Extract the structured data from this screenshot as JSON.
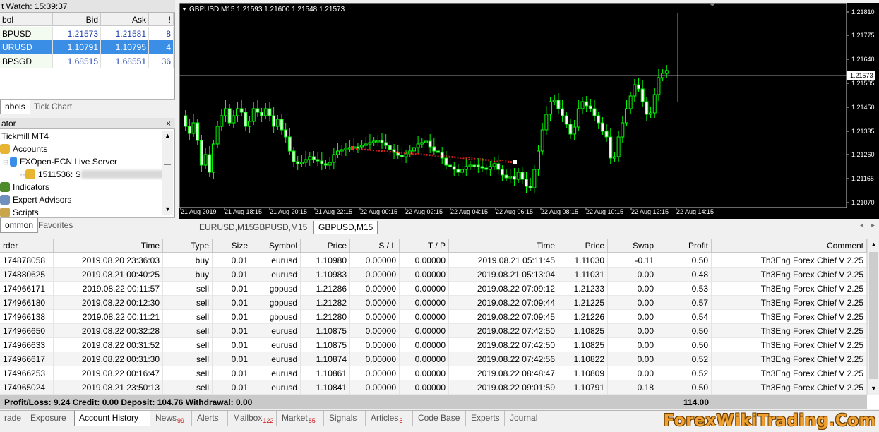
{
  "market_watch": {
    "title": "t Watch: 15:39:37",
    "columns": [
      "bol",
      "Bid",
      "Ask",
      "!"
    ],
    "rows": [
      {
        "symbol": "BPUSD",
        "bid": "1.21573",
        "ask": "1.21581",
        "spread": "8",
        "selected": false
      },
      {
        "symbol": "URUSD",
        "bid": "1.10791",
        "ask": "1.10795",
        "spread": "4",
        "selected": true
      },
      {
        "symbol": "BPSGD",
        "bid": "1.68515",
        "ask": "1.68551",
        "spread": "36",
        "selected": false
      }
    ],
    "tabs": [
      "nbols",
      "Tick Chart"
    ]
  },
  "navigator": {
    "title": "ator",
    "close": "×",
    "items": [
      "Tickmill MT4",
      "Accounts",
      "FXOpen-ECN Live Server",
      "1511536: S",
      "Indicators",
      "Expert Advisors",
      "Scripts"
    ],
    "tabs": [
      "ommon",
      "Favorites"
    ]
  },
  "chart": {
    "header": "GBPUSD,M15  1.21593 1.21600 1.21548 1.21573",
    "current_price": "1.21573",
    "price_labels": [
      "1.21810",
      "1.21775",
      "1.21640",
      "1.21505",
      "1.21450",
      "1.21335",
      "1.21260",
      "1.21165",
      "1.21070"
    ],
    "time_labels": [
      "21 Aug 2019",
      "21 Aug 18:15",
      "21 Aug 20:15",
      "21 Aug 22:15",
      "22 Aug 00:15",
      "22 Aug 02:15",
      "22 Aug 04:15",
      "22 Aug 06:15",
      "22 Aug 08:15",
      "22 Aug 10:15",
      "22 Aug 12:15",
      "22 Aug 14:15"
    ],
    "tabs": [
      "EURUSD,M15",
      "GBPUSD,M15",
      "GBPUSD,M15"
    ]
  },
  "terminal": {
    "columns": [
      "rder",
      "Time",
      "Type",
      "Size",
      "Symbol",
      "Price",
      "S / L",
      "T / P",
      "Time",
      "Price",
      "Swap",
      "Profit",
      "Comment"
    ],
    "rows": [
      [
        "174878058",
        "2019.08.20 23:36:03",
        "buy",
        "0.01",
        "eurusd",
        "1.10980",
        "0.00000",
        "0.00000",
        "2019.08.21 05:11:45",
        "1.11030",
        "-0.11",
        "0.50",
        "Th3Eng Forex Chief V 2.25"
      ],
      [
        "174880625",
        "2019.08.21 00:40:25",
        "buy",
        "0.01",
        "eurusd",
        "1.10983",
        "0.00000",
        "0.00000",
        "2019.08.21 05:13:04",
        "1.11031",
        "0.00",
        "0.48",
        "Th3Eng Forex Chief V 2.25"
      ],
      [
        "174966171",
        "2019.08.22 00:11:57",
        "sell",
        "0.01",
        "gbpusd",
        "1.21286",
        "0.00000",
        "0.00000",
        "2019.08.22 07:09:12",
        "1.21233",
        "0.00",
        "0.53",
        "Th3Eng Forex Chief V 2.25"
      ],
      [
        "174966180",
        "2019.08.22 00:12:30",
        "sell",
        "0.01",
        "gbpusd",
        "1.21282",
        "0.00000",
        "0.00000",
        "2019.08.22 07:09:44",
        "1.21225",
        "0.00",
        "0.57",
        "Th3Eng Forex Chief V 2.25"
      ],
      [
        "174966138",
        "2019.08.22 00:11:21",
        "sell",
        "0.01",
        "gbpusd",
        "1.21280",
        "0.00000",
        "0.00000",
        "2019.08.22 07:09:45",
        "1.21226",
        "0.00",
        "0.54",
        "Th3Eng Forex Chief V 2.25"
      ],
      [
        "174966650",
        "2019.08.22 00:32:28",
        "sell",
        "0.01",
        "eurusd",
        "1.10875",
        "0.00000",
        "0.00000",
        "2019.08.22 07:42:50",
        "1.10825",
        "0.00",
        "0.50",
        "Th3Eng Forex Chief V 2.25"
      ],
      [
        "174966633",
        "2019.08.22 00:31:52",
        "sell",
        "0.01",
        "eurusd",
        "1.10875",
        "0.00000",
        "0.00000",
        "2019.08.22 07:42:50",
        "1.10825",
        "0.00",
        "0.50",
        "Th3Eng Forex Chief V 2.25"
      ],
      [
        "174966617",
        "2019.08.22 00:31:30",
        "sell",
        "0.01",
        "eurusd",
        "1.10874",
        "0.00000",
        "0.00000",
        "2019.08.22 07:42:56",
        "1.10822",
        "0.00",
        "0.52",
        "Th3Eng Forex Chief V 2.25"
      ],
      [
        "174966253",
        "2019.08.22 00:16:47",
        "sell",
        "0.01",
        "eurusd",
        "1.10861",
        "0.00000",
        "0.00000",
        "2019.08.22 08:48:47",
        "1.10809",
        "0.00",
        "0.52",
        "Th3Eng Forex Chief V 2.25"
      ],
      [
        "174965024",
        "2019.08.21 23:50:13",
        "sell",
        "0.01",
        "eurusd",
        "1.10841",
        "0.00000",
        "0.00000",
        "2019.08.22 09:01:59",
        "1.10791",
        "0.18",
        "0.50",
        "Th3Eng Forex Chief V 2.25"
      ]
    ],
    "summary": "Profit/Loss: 9.24  Credit: 0.00  Deposit: 104.76  Withdrawal: 0.00",
    "summary_total": "114.00"
  },
  "bottom_tabs": [
    {
      "label": "rade",
      "badge": ""
    },
    {
      "label": "Exposure",
      "badge": ""
    },
    {
      "label": "Account History",
      "badge": "",
      "active": true
    },
    {
      "label": "News",
      "badge": "99"
    },
    {
      "label": "Alerts",
      "badge": ""
    },
    {
      "label": "Mailbox",
      "badge": "122"
    },
    {
      "label": "Market",
      "badge": "85"
    },
    {
      "label": "Signals",
      "badge": ""
    },
    {
      "label": "Articles",
      "badge": "5"
    },
    {
      "label": "Code Base",
      "badge": ""
    },
    {
      "label": "Experts",
      "badge": ""
    },
    {
      "label": "Journal",
      "badge": ""
    }
  ],
  "watermark": "ForexWikiTrading.Com",
  "colors": {
    "selection": "#3b8ee5",
    "bull": "#00ff00",
    "chart_bg": "#000000",
    "badge": "#d01010"
  }
}
